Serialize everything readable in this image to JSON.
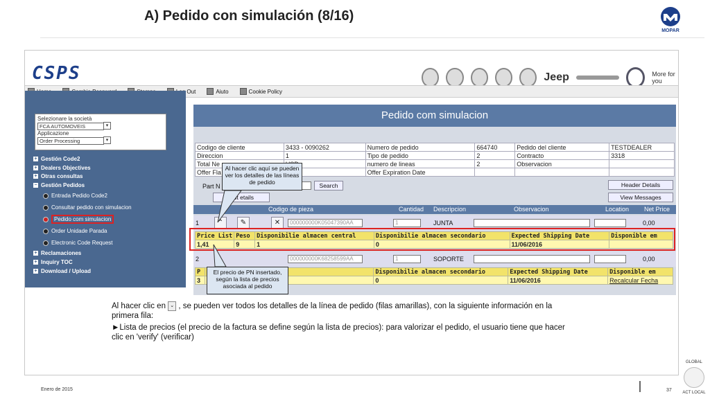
{
  "slide": {
    "title": "A) Pedido con simulación (8/16)",
    "footer_date": "Enero de 2015",
    "page_number": "37"
  },
  "logos": {
    "mopar": "MOPAR",
    "global_top": "GLOBAL",
    "global_bottom": "ACT LOCAL"
  },
  "app": {
    "logo": "CSPS",
    "brands": [
      "fiat-logo",
      "alfa-romeo-logo",
      "lancia-logo",
      "abarth-logo",
      "ferrari-style-logo"
    ],
    "jeep_label": "Jeep",
    "chrysler_label": "CHRYSLER",
    "more_for_you": "More for you",
    "toolbar": [
      {
        "label": "Home",
        "icon": "home-icon"
      },
      {
        "label": "Cambia Password",
        "icon": "key-icon"
      },
      {
        "label": "Stampa",
        "icon": "printer-icon"
      },
      {
        "label": "Log Out",
        "icon": "logout-icon"
      },
      {
        "label": "Aiuto",
        "icon": "help-icon"
      },
      {
        "label": "Cookie Policy",
        "icon": "cookie-icon"
      }
    ]
  },
  "sidebar": {
    "company_label": "Selezionare la società",
    "company_value": "FCA AUTOMOVEIS",
    "app_label": "Applicazione",
    "app_value": "Order Processing",
    "menu": [
      {
        "label": "Gestión Code2",
        "sign": "+"
      },
      {
        "label": "Dealers Objectives",
        "sign": "+"
      },
      {
        "label": "Otras consultas",
        "sign": "+"
      },
      {
        "label": "Gestión Pedidos",
        "sign": "−"
      }
    ],
    "submenu": [
      {
        "label": "Entrada Pedido Code2"
      },
      {
        "label": "Consultar pedido con simulacion"
      },
      {
        "label": "Pedido com simulacion"
      },
      {
        "label": "Order Unidade Parada"
      },
      {
        "label": "Electronic Code Request"
      }
    ],
    "menu2": [
      {
        "label": "Reclamaciones",
        "sign": "+"
      },
      {
        "label": "Inquiry TOC",
        "sign": "+"
      },
      {
        "label": "Download / Upload",
        "sign": "+"
      }
    ]
  },
  "form": {
    "header": "Pedido com simulacion",
    "info_rows": [
      [
        "Codigo de cliente",
        "3433 - 0090262",
        "Numero de pedido",
        "664740",
        "Pedido del cliente",
        "TESTDEALER"
      ],
      [
        "Direccion",
        "1",
        "Tipo de pedido",
        "2",
        "Contracto",
        "3318"
      ],
      [
        "Total Ne",
        "USD",
        "numero de lineas",
        "2",
        "Observacion",
        ""
      ],
      [
        "Offer Fla",
        "",
        "Offer Expiration Date",
        "",
        "",
        ""
      ]
    ],
    "part_label": "Part N",
    "search_btn": "Search",
    "header_details_btn": "Header Details",
    "options_btn": "Opt  etails",
    "view_messages_btn": "View Messages",
    "col_headers": [
      "Codigo de pieza",
      "Cantidad",
      "Descripcion",
      "Observacion",
      "Location",
      "Net Price"
    ],
    "lines": [
      {
        "no": "1",
        "code": "000000000K05047390AA",
        "qty": "1",
        "desc": "JUNTA",
        "price": "0,00"
      },
      {
        "no": "2",
        "code": "000000000K68258599AA",
        "qty": "1",
        "desc": "SOPORTE",
        "price": "0,00"
      }
    ],
    "detail_headers": [
      "Price List",
      "Peso",
      "Disponibilie almacen central",
      "Disponibilie almacen secondario",
      "Expected Shipping Date",
      "Disponible em"
    ],
    "detail1": [
      "1,41",
      "9",
      "1",
      "0",
      "11/06/2016",
      ""
    ],
    "detail2_headers": [
      "P",
      "ilie almacen central",
      "Disponibilie almacen secondario",
      "Expected Shipping Date",
      "Disponible em"
    ],
    "detail2": [
      "3",
      "",
      "0",
      "11/06/2016",
      "Recalcular Fecha"
    ]
  },
  "callouts": {
    "top": "Al hacer clic aquí se pueden ver los detalles de las líneas de pedido",
    "bottom": "El precio de PN insertado, según la lista de precios asociada al pedido"
  },
  "caption": {
    "line1a": "Al hacer clic en",
    "line1b": ", se pueden ver todos los detalles de la línea de pedido (filas amarillas), con la siguiente información en la",
    "line2": "primera fila:",
    "line3": "►Lista de precios (el precio de la factura se define según la lista de precios): para valorizar el pedido, el usuario tiene que hacer",
    "line4": "clic en 'verify' (verificar)"
  }
}
